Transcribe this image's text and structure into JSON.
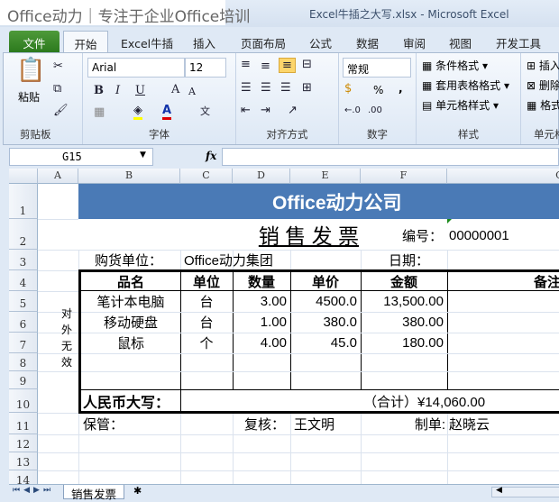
{
  "window": {
    "brand": "Office动力｜专注于企业Office培训",
    "title": "Excel牛插之大写.xlsx - Microsoft Excel"
  },
  "tabs": [
    "文件",
    "开始",
    "Excel牛插",
    "插入",
    "页面布局",
    "公式",
    "数据",
    "审阅",
    "视图",
    "开发工具"
  ],
  "ribbon": {
    "clipboard": {
      "label": "剪贴板",
      "paste": "粘贴"
    },
    "font": {
      "label": "字体",
      "name": "Arial",
      "size": "12"
    },
    "alignment": {
      "label": "对齐方式"
    },
    "number": {
      "label": "数字",
      "format": "常规",
      "percent": "%",
      "comma": ","
    },
    "styles": {
      "label": "样式",
      "items": [
        "条件格式 ▾",
        "套用表格格式 ▾",
        "单元格样式 ▾"
      ]
    },
    "cells": {
      "label": "单元格",
      "items": [
        "插入",
        "删除",
        "格式"
      ]
    }
  },
  "formula_bar": {
    "name_box": "G15",
    "fx": "fx",
    "value": ""
  },
  "columns": [
    "A",
    "B",
    "C",
    "D",
    "E",
    "F",
    "G"
  ],
  "rows": [
    "1",
    "2",
    "3",
    "4",
    "5",
    "6",
    "7",
    "8",
    "9",
    "10",
    "11",
    "12",
    "13",
    "14"
  ],
  "sheet": {
    "company": "Office动力公司",
    "title": "销 售 发 票",
    "number_label": "编号：",
    "number": "00000001",
    "buyer_label": "购货单位：",
    "buyer": "Office动力集团",
    "date_label": "日期：",
    "side_note": [
      "对",
      "外",
      "无",
      "效"
    ],
    "headers": [
      "品名",
      "单位",
      "数量",
      "单价",
      "金额",
      "备注"
    ],
    "items": [
      {
        "name": "笔计本电脑",
        "unit": "台",
        "qty": "3.00",
        "price": "4500.0",
        "amount": "13,500.00"
      },
      {
        "name": "移动硬盘",
        "unit": "台",
        "qty": "1.00",
        "price": "380.0",
        "amount": "380.00"
      },
      {
        "name": "鼠标",
        "unit": "个",
        "qty": "4.00",
        "price": "45.0",
        "amount": "180.00"
      }
    ],
    "rmb_label": "人民币大写：",
    "total": "（合计）¥14,060.00",
    "keeper_label": "保管：",
    "reviewer_label": "复核：",
    "reviewer": "王文明",
    "maker_label": "制单:",
    "maker": "赵晓云"
  },
  "sheet_tabs": [
    "销售发票"
  ]
}
